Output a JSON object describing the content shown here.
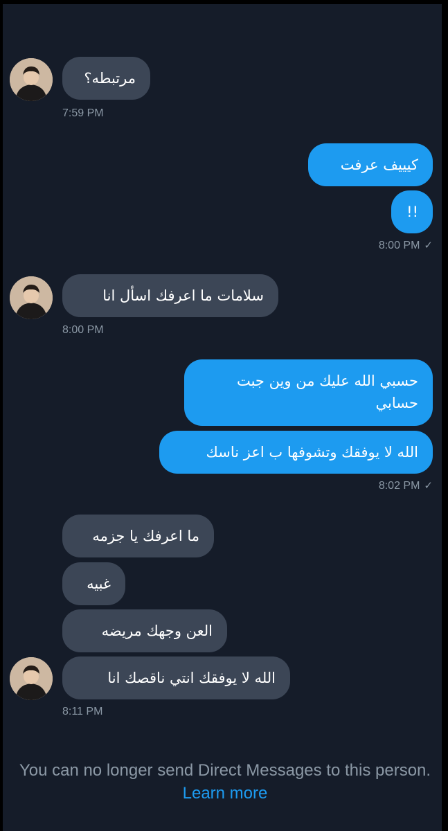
{
  "messages": [
    {
      "text": "مرتبطه؟",
      "time": "7:59 PM"
    },
    {
      "text": "كيييف عرفت"
    },
    {
      "text": "!!",
      "time": "8:00 PM",
      "status": "✓"
    },
    {
      "text": "سلامات ما اعرفك اسأل انا",
      "time": "8:00 PM"
    },
    {
      "line1": "حسبي الله عليك من وين جبت",
      "line2": "حسابي"
    },
    {
      "text": "الله لا يوفقك وتشوفها ب اعز ناسك",
      "time": "8:02 PM",
      "status": "✓"
    },
    {
      "text": "ما اعرفك يا جزمه"
    },
    {
      "text": "غبيه"
    },
    {
      "text": "العن وجهك مريضه"
    },
    {
      "text": "الله لا يوفقك انتي ناقصك انا",
      "time": "8:11 PM"
    }
  ],
  "notice": {
    "text": "You can no longer send Direct Messages to this person.",
    "link": "Learn more"
  },
  "colors": {
    "background": "#151c29",
    "incoming_bubble": "#3c4656",
    "outgoing_bubble": "#1d9bf0",
    "secondary_text": "#8b98a5"
  }
}
